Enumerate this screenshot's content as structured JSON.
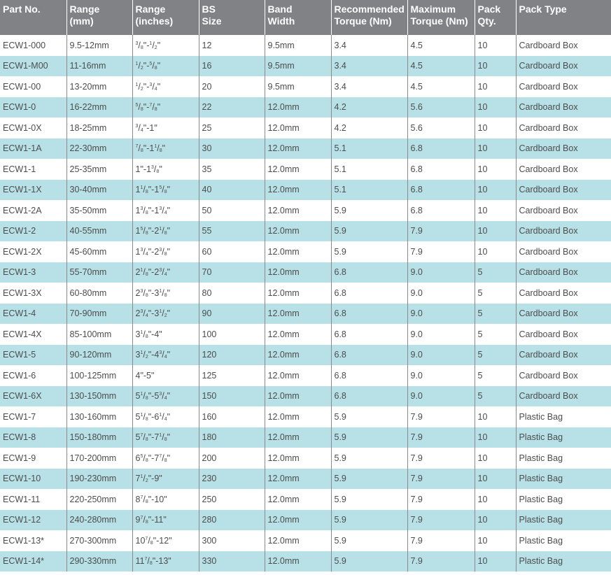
{
  "headers": [
    {
      "line1": "Part No.",
      "line2": ""
    },
    {
      "line1": "Range",
      "line2": "(mm)"
    },
    {
      "line1": "Range",
      "line2": "(inches)"
    },
    {
      "line1": "BS",
      "line2": "Size"
    },
    {
      "line1": "Band",
      "line2": "Width"
    },
    {
      "line1": "Recommended",
      "line2": "Torque (Nm)"
    },
    {
      "line1": "Maximum",
      "line2": "Torque (Nm)"
    },
    {
      "line1": "Pack",
      "line2": "Qty."
    },
    {
      "line1": "Pack Type",
      "line2": ""
    }
  ],
  "rows": [
    {
      "part": "ECW1-000",
      "range_mm": "9.5-12mm",
      "inches": [
        [
          "",
          "3",
          "8"
        ],
        "\"-",
        [
          "",
          "1",
          "2"
        ],
        "\""
      ],
      "bs": "12",
      "band": "9.5mm",
      "rec": "3.4",
      "max": "4.5",
      "qty": "10",
      "pack": "Cardboard Box"
    },
    {
      "part": "ECW1-M00",
      "range_mm": "11-16mm",
      "inches": [
        [
          "",
          "1",
          "2"
        ],
        "\"-",
        [
          "",
          "5",
          "8"
        ],
        "\""
      ],
      "bs": "16",
      "band": "9.5mm",
      "rec": "3.4",
      "max": "4.5",
      "qty": "10",
      "pack": "Cardboard Box"
    },
    {
      "part": "ECW1-00",
      "range_mm": "13-20mm",
      "inches": [
        [
          "",
          "1",
          "2"
        ],
        "\"-",
        [
          "",
          "3",
          "4"
        ],
        "\""
      ],
      "bs": "20",
      "band": "9.5mm",
      "rec": "3.4",
      "max": "4.5",
      "qty": "10",
      "pack": "Cardboard Box"
    },
    {
      "part": "ECW1-0",
      "range_mm": "16-22mm",
      "inches": [
        [
          "",
          "5",
          "8"
        ],
        "\"-",
        [
          "",
          "7",
          "8"
        ],
        "\""
      ],
      "bs": "22",
      "band": "12.0mm",
      "rec": "4.2",
      "max": "5.6",
      "qty": "10",
      "pack": "Cardboard Box"
    },
    {
      "part": "ECW1-0X",
      "range_mm": "18-25mm",
      "inches": [
        [
          "",
          "3",
          "4"
        ],
        "\"-1\""
      ],
      "bs": "25",
      "band": "12.0mm",
      "rec": "4.2",
      "max": "5.6",
      "qty": "10",
      "pack": "Cardboard Box"
    },
    {
      "part": "ECW1-1A",
      "range_mm": "22-30mm",
      "inches": [
        [
          "",
          "7",
          "8"
        ],
        "\"-",
        [
          "1",
          "1",
          "8"
        ],
        "\""
      ],
      "bs": "30",
      "band": "12.0mm",
      "rec": "5.1",
      "max": "6.8",
      "qty": "10",
      "pack": "Cardboard Box"
    },
    {
      "part": "ECW1-1",
      "range_mm": "25-35mm",
      "inches": [
        "1\"-",
        [
          "1",
          "3",
          "8"
        ],
        "\""
      ],
      "bs": "35",
      "band": "12.0mm",
      "rec": "5.1",
      "max": "6.8",
      "qty": "10",
      "pack": "Cardboard Box"
    },
    {
      "part": "ECW1-1X",
      "range_mm": "30-40mm",
      "inches": [
        [
          "1",
          "1",
          "8"
        ],
        "\"-",
        [
          "1",
          "5",
          "8"
        ],
        "\""
      ],
      "bs": "40",
      "band": "12.0mm",
      "rec": "5.1",
      "max": "6.8",
      "qty": "10",
      "pack": "Cardboard Box"
    },
    {
      "part": "ECW1-2A",
      "range_mm": "35-50mm",
      "inches": [
        [
          "1",
          "3",
          "8"
        ],
        "\"-",
        [
          "1",
          "3",
          "4"
        ],
        "\""
      ],
      "bs": "50",
      "band": "12.0mm",
      "rec": "5.9",
      "max": "6.8",
      "qty": "10",
      "pack": "Cardboard Box"
    },
    {
      "part": "ECW1-2",
      "range_mm": "40-55mm",
      "inches": [
        [
          "1",
          "5",
          "8"
        ],
        "\"-",
        [
          "2",
          "1",
          "8"
        ],
        "\""
      ],
      "bs": "55",
      "band": "12.0mm",
      "rec": "5.9",
      "max": "7.9",
      "qty": "10",
      "pack": "Cardboard Box"
    },
    {
      "part": "ECW1-2X",
      "range_mm": "45-60mm",
      "inches": [
        [
          "1",
          "3",
          "4"
        ],
        "\"-",
        [
          "2",
          "3",
          "8"
        ],
        "\""
      ],
      "bs": "60",
      "band": "12.0mm",
      "rec": "5.9",
      "max": "7.9",
      "qty": "10",
      "pack": "Cardboard Box"
    },
    {
      "part": "ECW1-3",
      "range_mm": "55-70mm",
      "inches": [
        [
          "2",
          "1",
          "8"
        ],
        "\"-",
        [
          "2",
          "3",
          "4"
        ],
        "\""
      ],
      "bs": "70",
      "band": "12.0mm",
      "rec": "6.8",
      "max": "9.0",
      "qty": "5",
      "pack": "Cardboard Box"
    },
    {
      "part": "ECW1-3X",
      "range_mm": "60-80mm",
      "inches": [
        [
          "2",
          "3",
          "8"
        ],
        "\"-",
        [
          "3",
          "1",
          "8"
        ],
        "\""
      ],
      "bs": "80",
      "band": "12.0mm",
      "rec": "6.8",
      "max": "9.0",
      "qty": "5",
      "pack": "Cardboard Box"
    },
    {
      "part": "ECW1-4",
      "range_mm": "70-90mm",
      "inches": [
        [
          "2",
          "3",
          "4"
        ],
        "\"-",
        [
          "3",
          "1",
          "2"
        ],
        "\""
      ],
      "bs": "90",
      "band": "12.0mm",
      "rec": "6.8",
      "max": "9.0",
      "qty": "5",
      "pack": "Cardboard Box"
    },
    {
      "part": "ECW1-4X",
      "range_mm": "85-100mm",
      "inches": [
        [
          "3",
          "1",
          "8"
        ],
        "\"-4\""
      ],
      "bs": "100",
      "band": "12.0mm",
      "rec": "6.8",
      "max": "9.0",
      "qty": "5",
      "pack": "Cardboard Box"
    },
    {
      "part": "ECW1-5",
      "range_mm": "90-120mm",
      "inches": [
        [
          "3",
          "1",
          "2"
        ],
        "\"-",
        [
          "4",
          "3",
          "4"
        ],
        "\""
      ],
      "bs": "120",
      "band": "12.0mm",
      "rec": "6.8",
      "max": "9.0",
      "qty": "5",
      "pack": "Cardboard Box"
    },
    {
      "part": "ECW1-6",
      "range_mm": "100-125mm",
      "inches": [
        "4\"-5\""
      ],
      "bs": "125",
      "band": "12.0mm",
      "rec": "6.8",
      "max": "9.0",
      "qty": "5",
      "pack": "Cardboard Box"
    },
    {
      "part": "ECW1-6X",
      "range_mm": "130-150mm",
      "inches": [
        [
          "5",
          "1",
          "8"
        ],
        "\"-",
        [
          "5",
          "3",
          "4"
        ],
        "\""
      ],
      "bs": "150",
      "band": "12.0mm",
      "rec": "6.8",
      "max": "9.0",
      "qty": "5",
      "pack": "Cardboard Box"
    },
    {
      "part": "ECW1-7",
      "range_mm": "130-160mm",
      "inches": [
        [
          "5",
          "1",
          "8"
        ],
        "\"-",
        [
          "6",
          "1",
          "4"
        ],
        "\""
      ],
      "bs": "160",
      "band": "12.0mm",
      "rec": "5.9",
      "max": "7.9",
      "qty": "10",
      "pack": "Plastic Bag"
    },
    {
      "part": "ECW1-8",
      "range_mm": "150-180mm",
      "inches": [
        [
          "5",
          "7",
          "8"
        ],
        "\"-",
        [
          "7",
          "1",
          "8"
        ],
        "\""
      ],
      "bs": "180",
      "band": "12.0mm",
      "rec": "5.9",
      "max": "7.9",
      "qty": "10",
      "pack": "Plastic Bag"
    },
    {
      "part": "ECW1-9",
      "range_mm": "170-200mm",
      "inches": [
        [
          "6",
          "5",
          "8"
        ],
        "\"-",
        [
          "7",
          "7",
          "8"
        ],
        "\""
      ],
      "bs": "200",
      "band": "12.0mm",
      "rec": "5.9",
      "max": "7.9",
      "qty": "10",
      "pack": "Plastic Bag"
    },
    {
      "part": "ECW1-10",
      "range_mm": "190-230mm",
      "inches": [
        [
          "7",
          "1",
          "2"
        ],
        "\"-9\""
      ],
      "bs": "230",
      "band": "12.0mm",
      "rec": "5.9",
      "max": "7.9",
      "qty": "10",
      "pack": "Plastic Bag"
    },
    {
      "part": "ECW1-11",
      "range_mm": "220-250mm",
      "inches": [
        [
          "8",
          "7",
          "8"
        ],
        "\"-10\""
      ],
      "bs": "250",
      "band": "12.0mm",
      "rec": "5.9",
      "max": "7.9",
      "qty": "10",
      "pack": "Plastic Bag"
    },
    {
      "part": "ECW1-12",
      "range_mm": "240-280mm",
      "inches": [
        [
          "9",
          "7",
          "8"
        ],
        "\"-11\""
      ],
      "bs": "280",
      "band": "12.0mm",
      "rec": "5.9",
      "max": "7.9",
      "qty": "10",
      "pack": "Plastic Bag"
    },
    {
      "part": "ECW1-13*",
      "range_mm": "270-300mm",
      "inches": [
        [
          "10",
          "7",
          "8"
        ],
        "\"-12\""
      ],
      "bs": "300",
      "band": "12.0mm",
      "rec": "5.9",
      "max": "7.9",
      "qty": "10",
      "pack": "Plastic Bag"
    },
    {
      "part": "ECW1-14*",
      "range_mm": "290-330mm",
      "inches": [
        [
          "11",
          "7",
          "8"
        ],
        "\"-13\""
      ],
      "bs": "330",
      "band": "12.0mm",
      "rec": "5.9",
      "max": "7.9",
      "qty": "10",
      "pack": "Plastic Bag"
    }
  ],
  "colors": {
    "header_bg": "#808285",
    "row_alt": "#b7e1e6",
    "text": "#4d4d4d"
  }
}
